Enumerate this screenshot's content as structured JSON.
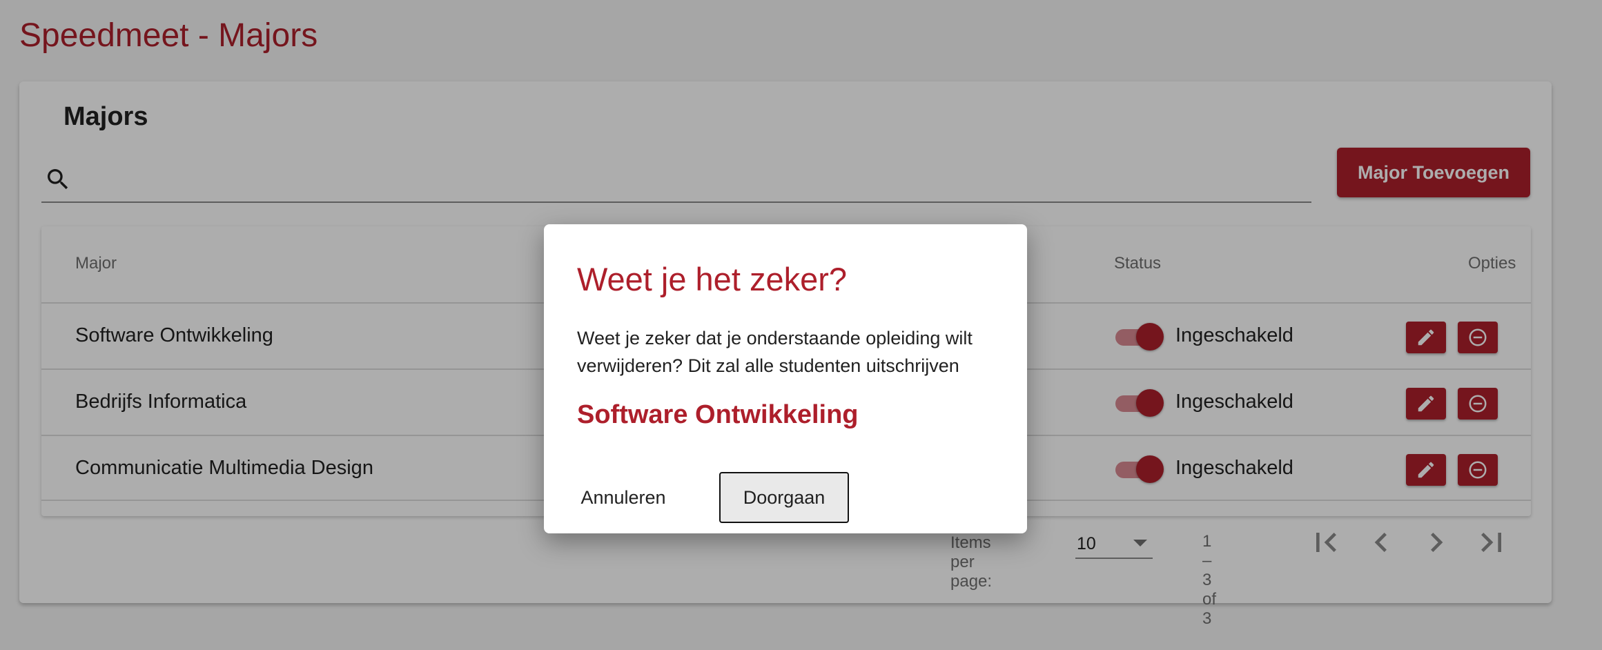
{
  "page": {
    "title": "Speedmeet - Majors"
  },
  "card": {
    "title": "Majors"
  },
  "search": {
    "placeholder": "",
    "value": ""
  },
  "toolbar": {
    "add_label": "Major Toevoegen"
  },
  "table": {
    "columns": {
      "major": "Major",
      "status": "Status",
      "options": "Opties"
    },
    "rows": [
      {
        "name": "Software Ontwikkeling",
        "status": "Ingeschakeld",
        "enabled": true
      },
      {
        "name": "Bedrijfs Informatica",
        "status": "Ingeschakeld",
        "enabled": true
      },
      {
        "name": "Communicatie Multimedia Design",
        "status": "Ingeschakeld",
        "enabled": true
      }
    ]
  },
  "paginator": {
    "items_per_page_label": "Items per page:",
    "items_per_page_value": "10",
    "range_label": "1 – 3 of 3"
  },
  "dialog": {
    "title": "Weet je het zeker?",
    "body": "Weet je zeker dat je onderstaande opleiding wilt verwijderen? Dit zal alle studenten uitschrijven",
    "major_name": "Software Ontwikkeling",
    "cancel_label": "Annuleren",
    "confirm_label": "Doorgaan"
  },
  "colors": {
    "accent": "#ad1f2b",
    "toggle_track": "#d98a92",
    "background": "#f5f5f5"
  },
  "icons": {
    "search": "search-icon",
    "edit": "pencil-icon",
    "delete": "minus-circle-icon",
    "first_page": "first-page-icon",
    "prev_page": "chevron-left-icon",
    "next_page": "chevron-right-icon",
    "last_page": "last-page-icon"
  }
}
